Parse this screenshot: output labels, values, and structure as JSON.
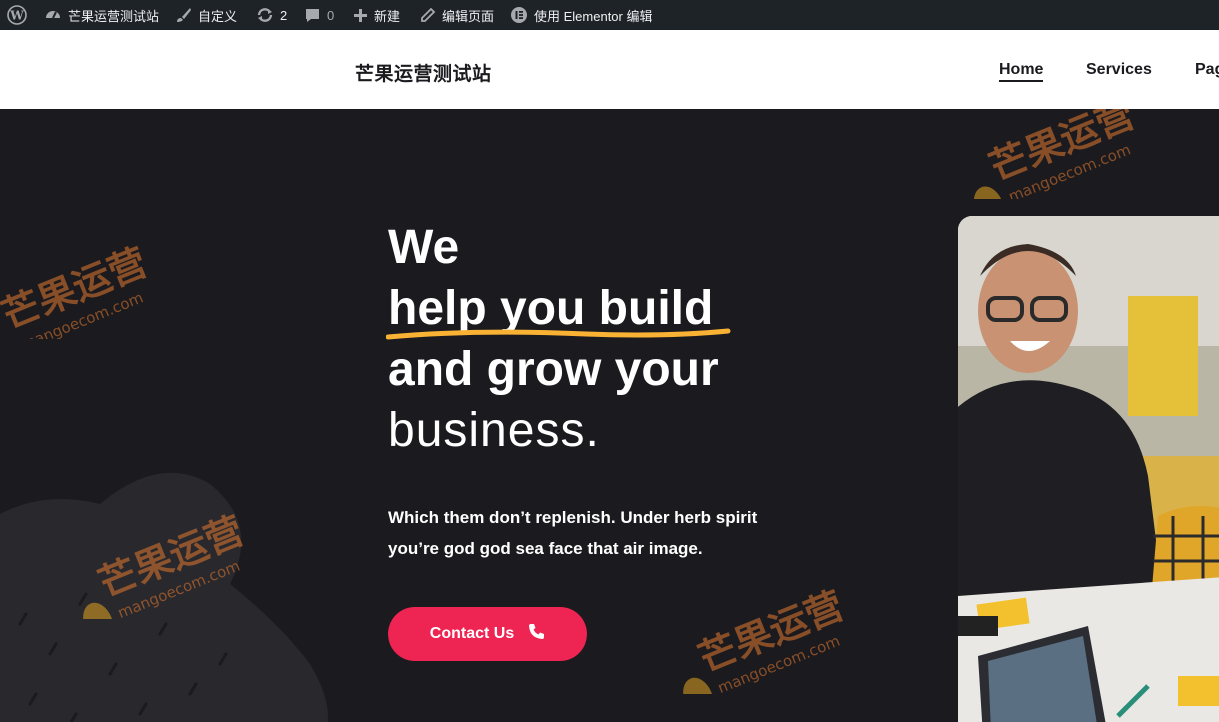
{
  "adminbar": {
    "site_name": "芒果运营测试站",
    "customize": "自定义",
    "updates_count": "2",
    "comments_count": "0",
    "new_label": "新建",
    "edit_page": "编辑页面",
    "elementor_edit": "使用 Elementor 编辑",
    "icons": [
      "wordpress-icon",
      "dashboard-icon",
      "brush-icon",
      "updates-icon",
      "comment-icon",
      "plus-icon",
      "pencil-icon",
      "elementor-icon"
    ]
  },
  "header": {
    "site_title": "芒果运营测试站",
    "nav": [
      {
        "label": "Home",
        "active": true
      },
      {
        "label": "Services"
      },
      {
        "label": "Pag"
      }
    ]
  },
  "hero": {
    "heading_line1": "We",
    "heading_line2": "help you build",
    "heading_line3": "and grow your",
    "heading_line4": "business.",
    "description": "Which them don’t replenish. Under herb spirit you’re god god sea face that air image.",
    "cta_label": "Contact Us",
    "cta_icon": "phone-icon"
  },
  "colors": {
    "adminbar_bg": "#1d2327",
    "hero_bg": "#1b1a1f",
    "accent_button": "#ee2452",
    "underline": "#f9b233"
  },
  "watermark": {
    "text": "芒果运营",
    "subtext": "mangoecom.com"
  }
}
